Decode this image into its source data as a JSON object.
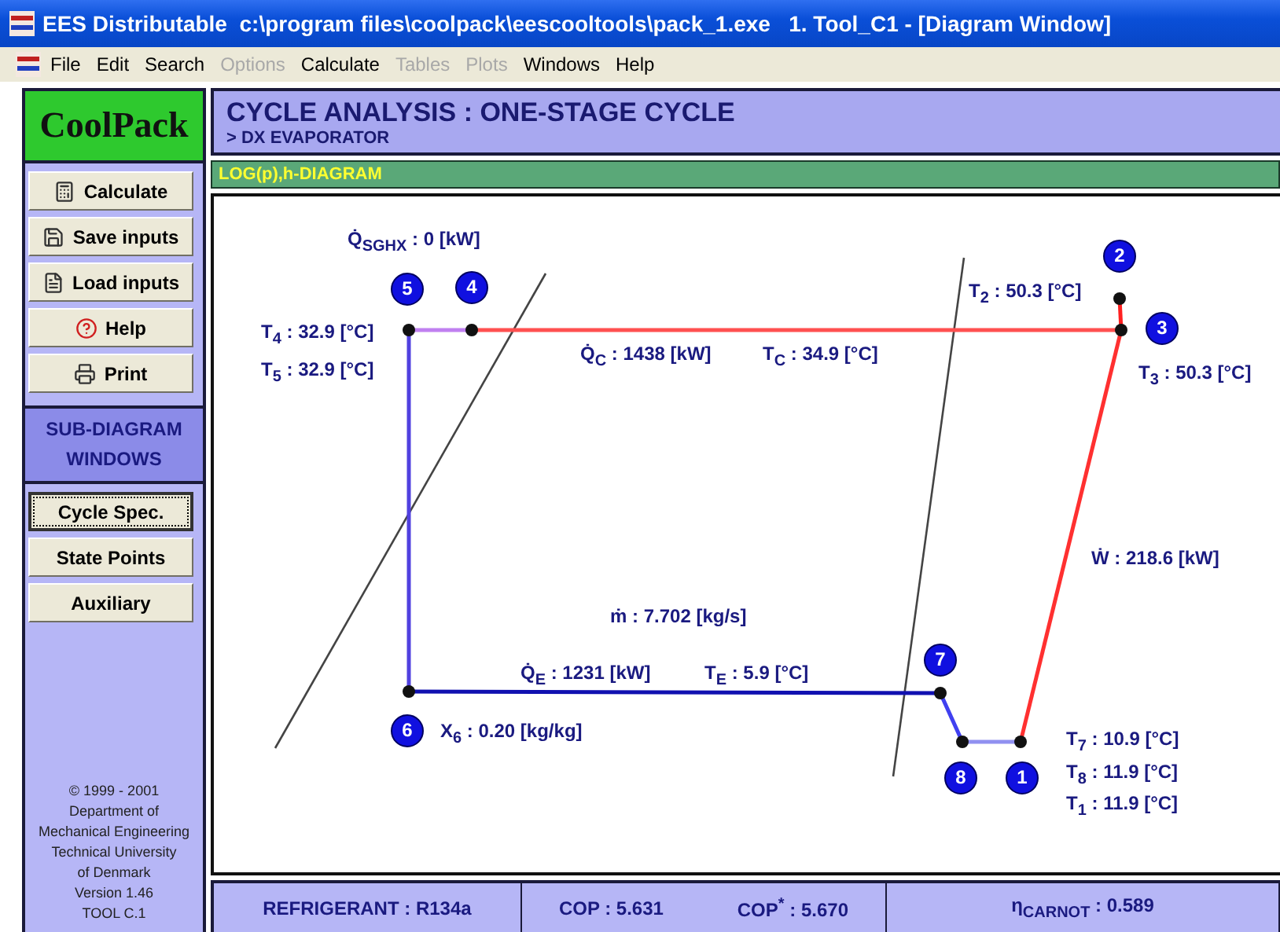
{
  "window": {
    "title": "EES Distributable  c:\\program files\\coolpack\\eescooltools\\pack_1.exe   1. Tool_C1 - [Diagram Window]"
  },
  "menu": [
    {
      "label": "File",
      "disabled": false
    },
    {
      "label": "Edit",
      "disabled": false
    },
    {
      "label": "Search",
      "disabled": false
    },
    {
      "label": "Options",
      "disabled": true
    },
    {
      "label": "Calculate",
      "disabled": false
    },
    {
      "label": "Tables",
      "disabled": true
    },
    {
      "label": "Plots",
      "disabled": true
    },
    {
      "label": "Windows",
      "disabled": false
    },
    {
      "label": "Help",
      "disabled": false
    }
  ],
  "sidebar": {
    "logo": "CoolPack",
    "buttons": [
      {
        "label": "Calculate",
        "kind": "calculator"
      },
      {
        "label": "Save inputs",
        "kind": "save"
      },
      {
        "label": "Load inputs",
        "kind": "load"
      },
      {
        "label": "Help",
        "kind": "help"
      },
      {
        "label": "Print",
        "kind": "print"
      }
    ],
    "section_title": "SUB-DIAGRAM WINDOWS",
    "sub_buttons": [
      {
        "label": "Cycle Spec.",
        "selected": true
      },
      {
        "label": "State Points",
        "selected": false
      },
      {
        "label": "Auxiliary",
        "selected": false
      }
    ],
    "footer": [
      "© 1999 - 2001",
      "Department of",
      "Mechanical Engineering",
      "Technical University",
      "of Denmark",
      "Version 1.46",
      "TOOL C.1"
    ]
  },
  "header": {
    "title": "CYCLE ANALYSIS : ONE-STAGE CYCLE",
    "subtitle": "> DX EVAPORATOR"
  },
  "diagram": {
    "tab": "LOG(p),h-DIAGRAM",
    "states": [
      "5",
      "4",
      "2",
      "3",
      "7",
      "8",
      "1",
      "6"
    ],
    "labels": [
      "Q̇$_{SGHX}$ : 0 [kW]",
      "T$_{4}$ :  32.9 [°C]",
      "T$_{5}$ :  32.9 [°C]",
      "Q̇$_{C}$ : 1438 [kW]",
      "T$_{C}$ : 34.9 [°C]",
      "T$_{2}$ :  50.3 [°C]",
      "T$_{3}$ :  50.3 [°C]",
      "Ẇ : 218.6 [kW]",
      "ṁ :  7.702 [kg/s]",
      "Q̇$_{E}$ : 1231 [kW]",
      "T$_{E}$ : 5.9 [°C]",
      "X$_{6}$ : 0.20 [kg/kg]",
      "T$_{7}$ : 10.9 [°C]",
      "T$_{8}$ : 11.9 [°C]",
      "T$_{1}$ : 11.9 [°C]"
    ]
  },
  "status": {
    "refrigerant": "REFRIGERANT : R134a",
    "cop": "COP : 5.631",
    "cop_star": "COP$^{*}$ : 5.670",
    "carnot": "η$_{CARNOT}$ :  0.589"
  }
}
